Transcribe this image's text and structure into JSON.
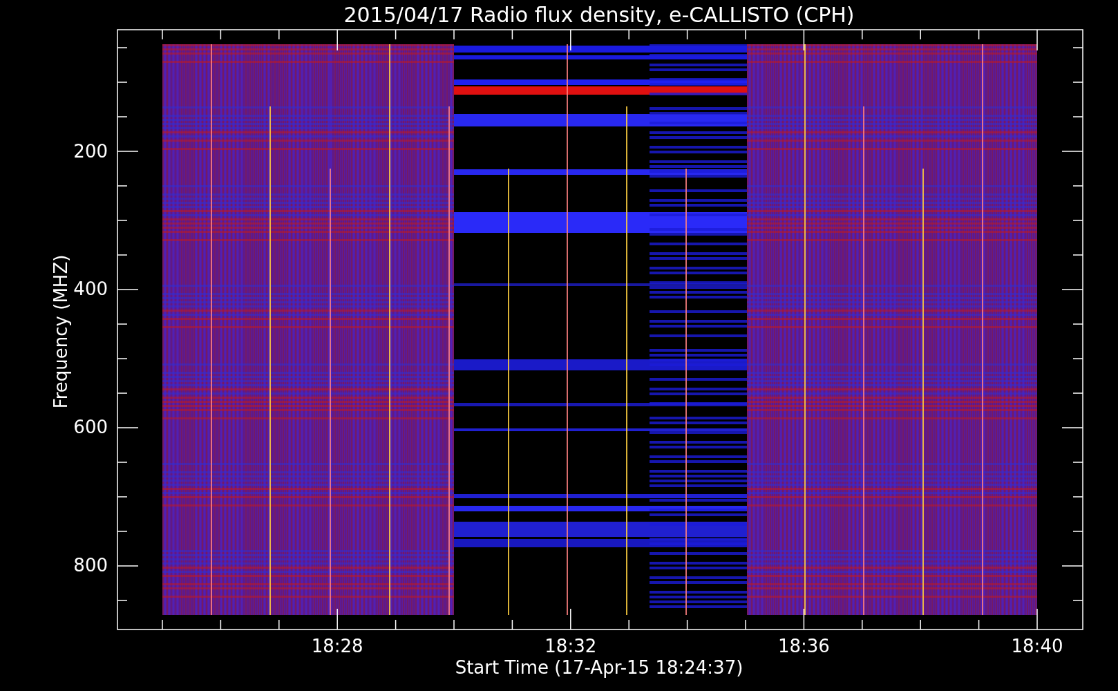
{
  "title": "2015/04/17  Radio flux density, e-CALLISTO (CPH)",
  "ylabel": "Frequency (MHZ)",
  "xlabel": "Start Time (17-Apr-15 18:24:37)",
  "yticks": [
    "200",
    "400",
    "600",
    "800"
  ],
  "xticks": [
    "18:28",
    "18:32",
    "18:36",
    "18:40"
  ]
}
